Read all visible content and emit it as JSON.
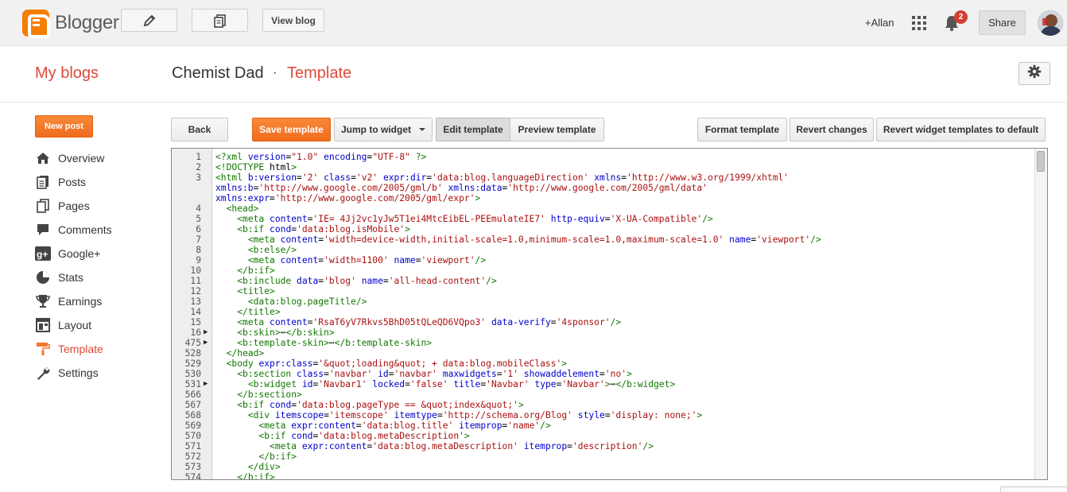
{
  "topbar": {
    "logo_text": "Blogger",
    "view_blog_label": "View blog",
    "user_name": "+Allan",
    "notification_count": "2",
    "share_label": "Share"
  },
  "titlebar": {
    "my_blogs": "My blogs",
    "blog_name": "Chemist Dad",
    "separator": "·",
    "page_name": "Template"
  },
  "sidebar": {
    "new_post": "New post",
    "items": [
      {
        "label": "Overview",
        "icon": "home-icon"
      },
      {
        "label": "Posts",
        "icon": "posts-icon"
      },
      {
        "label": "Pages",
        "icon": "pages-icon"
      },
      {
        "label": "Comments",
        "icon": "comments-icon"
      },
      {
        "label": "Google+",
        "icon": "google-plus-icon"
      },
      {
        "label": "Stats",
        "icon": "stats-icon"
      },
      {
        "label": "Earnings",
        "icon": "trophy-icon"
      },
      {
        "label": "Layout",
        "icon": "layout-icon"
      },
      {
        "label": "Template",
        "icon": "paint-roller-icon",
        "active": true
      },
      {
        "label": "Settings",
        "icon": "wrench-icon"
      }
    ]
  },
  "toolbar": {
    "back": "Back",
    "save_template": "Save template",
    "jump_to_widget": "Jump to widget",
    "edit_template": "Edit template",
    "preview_template": "Preview template",
    "format_template": "Format template",
    "revert_changes": "Revert changes",
    "revert_widgets": "Revert widget templates to default"
  },
  "colors": {
    "accent": "#dd4b39",
    "orange": "#f4762a",
    "tag": "#117700",
    "attr": "#0000cc",
    "string": "#aa1111"
  },
  "code": [
    {
      "n": "1",
      "fold": "",
      "src": "<?xml version=\"1.0\" encoding=\"UTF-8\" ?>"
    },
    {
      "n": "2",
      "fold": "",
      "src": "<!DOCTYPE html>"
    },
    {
      "n": "3",
      "fold": "",
      "src": "<html b:version='2' class='v2' expr:dir='data:blog.languageDirection' xmlns='http://www.w3.org/1999/xhtml'"
    },
    {
      "n": "",
      "fold": "",
      "src": "xmlns:b='http://www.google.com/2005/gml/b' xmlns:data='http://www.google.com/2005/gml/data'"
    },
    {
      "n": "",
      "fold": "",
      "src": "xmlns:expr='http://www.google.com/2005/gml/expr'>"
    },
    {
      "n": "4",
      "fold": "",
      "src": "  <head>"
    },
    {
      "n": "5",
      "fold": "",
      "src": "    <meta content='IE= 4Jj2vc1yJw5T1ei4MtcEibEL-PEEmulateIE7' http-equiv='X-UA-Compatible'/>"
    },
    {
      "n": "6",
      "fold": "",
      "src": "    <b:if cond='data:blog.isMobile'>"
    },
    {
      "n": "7",
      "fold": "",
      "src": "      <meta content='width=device-width,initial-scale=1.0,minimum-scale=1.0,maximum-scale=1.0' name='viewport'/>"
    },
    {
      "n": "8",
      "fold": "",
      "src": "      <b:else/>"
    },
    {
      "n": "9",
      "fold": "",
      "src": "      <meta content='width=1100' name='viewport'/>"
    },
    {
      "n": "10",
      "fold": "",
      "src": "    </b:if>"
    },
    {
      "n": "11",
      "fold": "",
      "src": "    <b:include data='blog' name='all-head-content'/>"
    },
    {
      "n": "12",
      "fold": "",
      "src": "    <title>"
    },
    {
      "n": "13",
      "fold": "",
      "src": "      <data:blog.pageTitle/>"
    },
    {
      "n": "14",
      "fold": "",
      "src": "    </title>"
    },
    {
      "n": "15",
      "fold": "",
      "src": "    <meta content='RsaT6yV7Rkvs5BhD05tQLeQD6VQpo3' data-verify='4sponsor'/>"
    },
    {
      "n": "16",
      "fold": "▶",
      "src": "    <b:skin>⋯</b:skin>"
    },
    {
      "n": "475",
      "fold": "▶",
      "src": "    <b:template-skin>⋯</b:template-skin>"
    },
    {
      "n": "528",
      "fold": "",
      "src": "  </head>"
    },
    {
      "n": "529",
      "fold": "",
      "src": "  <body expr:class='&quot;loading&quot; + data:blog.mobileClass'>"
    },
    {
      "n": "530",
      "fold": "",
      "src": "    <b:section class='navbar' id='navbar' maxwidgets='1' showaddelement='no'>"
    },
    {
      "n": "531",
      "fold": "▶",
      "src": "      <b:widget id='Navbar1' locked='false' title='Navbar' type='Navbar'>⋯</b:widget>"
    },
    {
      "n": "566",
      "fold": "",
      "src": "    </b:section>"
    },
    {
      "n": "567",
      "fold": "",
      "src": "    <b:if cond='data:blog.pageType == &quot;index&quot;'>"
    },
    {
      "n": "568",
      "fold": "",
      "src": "      <div itemscope='itemscope' itemtype='http://schema.org/Blog' style='display: none;'>"
    },
    {
      "n": "569",
      "fold": "",
      "src": "        <meta expr:content='data:blog.title' itemprop='name'/>"
    },
    {
      "n": "570",
      "fold": "",
      "src": "        <b:if cond='data:blog.metaDescription'>"
    },
    {
      "n": "571",
      "fold": "",
      "src": "          <meta expr:content='data:blog.metaDescription' itemprop='description'/>"
    },
    {
      "n": "572",
      "fold": "",
      "src": "        </b:if>"
    },
    {
      "n": "573",
      "fold": "",
      "src": "      </div>"
    },
    {
      "n": "574",
      "fold": "",
      "src": "    </b:if>"
    }
  ]
}
